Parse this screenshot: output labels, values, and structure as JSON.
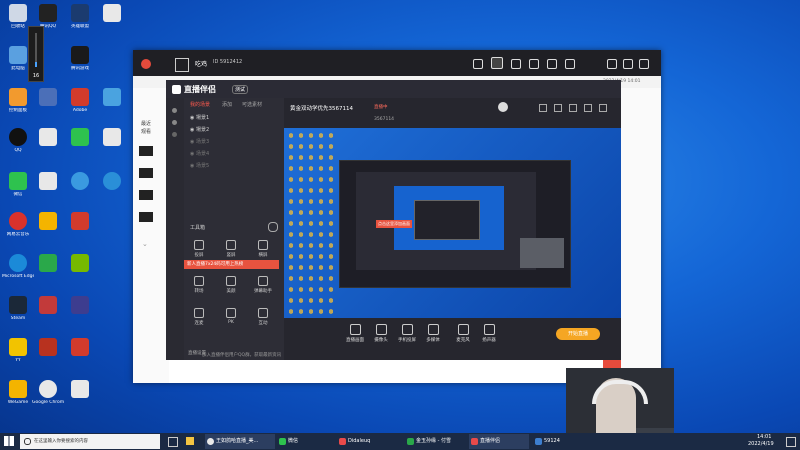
{
  "desktop": {
    "icons": [
      {
        "label": "回收站",
        "color": "#cfd8e6"
      },
      {
        "label": "Microsoft Edge",
        "color": "#1b8ad8"
      },
      {
        "label": "此电脑",
        "color": "#5aa0e0"
      },
      {
        "label": "控制面板",
        "color": "#3d7fd0"
      },
      {
        "label": "QQ",
        "color": "#ffffff"
      },
      {
        "label": "腾讯QQ",
        "color": "#222222"
      },
      {
        "label": "微信",
        "color": "#2ec24e"
      },
      {
        "label": "网易云音乐",
        "color": "#d9322c"
      },
      {
        "label": "WeGame",
        "color": "#f4b400"
      },
      {
        "label": "Steam",
        "color": "#1b2838"
      },
      {
        "label": "Google Chrome",
        "color": "#e8e8e8"
      },
      {
        "label": "YY",
        "color": "#f2c300"
      }
    ],
    "column3_icons": [
      "英雄联盟",
      "腾讯游戏",
      "Adobe",
      "Wallpaper Engine",
      "Chrome",
      "Opera"
    ]
  },
  "volume": {
    "level": 16,
    "level_text": "16"
  },
  "emulator": {
    "title": "吃鸡",
    "id_label": "ID 5912412",
    "timestamp": "2022/4/19 14:01",
    "side_labels": [
      "最近",
      "观看"
    ]
  },
  "companion": {
    "app_name": "直播伴侣",
    "badge": "测试",
    "tabs": [
      "我的场景",
      "添加",
      "可选素材"
    ],
    "scenes": [
      "場景1",
      "場景2",
      "场景3",
      "场景4",
      "场景5"
    ],
    "tools_title": "工具箱",
    "tools": [
      "投屏",
      "竖屏",
      "横屏",
      "转场",
      "美颜",
      "弹幕助手",
      "连麦",
      "PK",
      "互动"
    ],
    "tooltip": "新人直播7x24码可用上热榜",
    "room_title": "黄金双动学优先3567114",
    "room_status": "直播中",
    "preview_label": "3567114",
    "bottom_tools": [
      "直播画面",
      "摄像头",
      "手机投屏",
      "多媒体",
      "麦克风",
      "扬声器"
    ],
    "start_button": "开始直播",
    "footer_left": "直播设置",
    "footer_tip": "加入直播伴侣用户QQ群，获取最新资讯",
    "overlay_note": "点击这里添加画面"
  },
  "taskbar": {
    "search_placeholder": "在这里输入你要搜索的内容",
    "apps": [
      {
        "label": "王如鸽哈直播_美...",
        "color": "#e8e8e8"
      },
      {
        "label": "微信",
        "color": "#2ec24e"
      },
      {
        "label": "Didaleuq",
        "color": "#e84a4a"
      },
      {
        "label": "金玉孙缘 - 付雪",
        "color": "#2aa84a"
      },
      {
        "label": "直播伴侣",
        "color": "#e84a4a"
      },
      {
        "label": "59124",
        "color": "#3d7fd0"
      }
    ],
    "time": "14:01",
    "date": "2022/4/19"
  }
}
